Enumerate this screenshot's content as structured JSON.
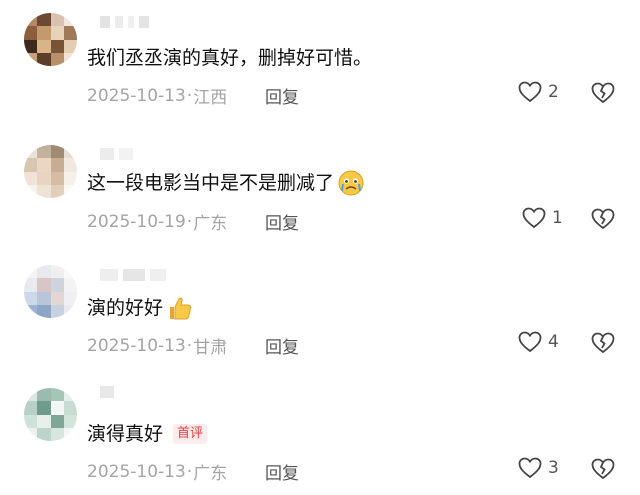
{
  "comments": [
    {
      "text": "我们丞丞演的真好，删掉好可惜。",
      "date": "2025-10-13",
      "location": "江西",
      "reply": "回复",
      "likes": "2",
      "emoji": "",
      "badge": ""
    },
    {
      "text": "这一段电影当中是不是删减了",
      "date": "2025-10-19",
      "location": "广东",
      "reply": "回复",
      "likes": "1",
      "emoji": "crying-face-icon",
      "badge": ""
    },
    {
      "text": "演的好好",
      "date": "2025-10-13",
      "location": "甘肃",
      "reply": "回复",
      "likes": "4",
      "emoji": "thumbs-up-icon",
      "badge": ""
    },
    {
      "text": "演得真好",
      "date": "2025-10-13",
      "location": "广东",
      "reply": "回复",
      "likes": "3",
      "emoji": "",
      "badge": "首评"
    }
  ],
  "separator": "·"
}
